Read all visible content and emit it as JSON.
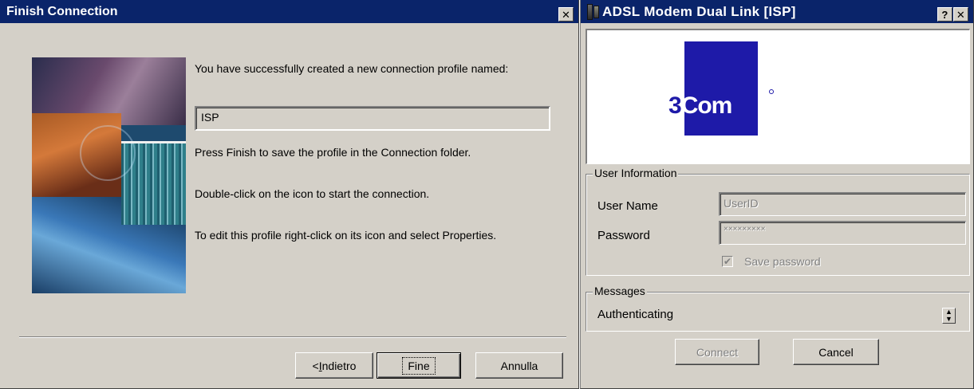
{
  "finish_dialog": {
    "title": "Finish Connection",
    "close_glyph": "✕",
    "intro_text": "You have successfully created a new connection profile named:",
    "profile_name": "ISP",
    "line_save": "Press Finish to save the profile in the Connection folder.",
    "line_start": "Double-click on the icon to start the connection.",
    "line_edit": "To edit this profile right-click on its icon and select Properties.",
    "back_prefix": "< ",
    "back_mnemonic": "I",
    "back_rest": "ndietro",
    "finish_label": "Fine",
    "cancel_label": "Annulla"
  },
  "adsl_dialog": {
    "title": "ADSL Modem Dual Link [ISP]",
    "help_glyph": "?",
    "close_glyph": "✕",
    "logo_text_3": "3",
    "logo_text_com": "Com",
    "user_info_label": "User Information",
    "user_name_label": "User Name",
    "user_name_value": "UserID",
    "password_label": "Password",
    "password_value": "×××××××××",
    "save_password_label": "Save password",
    "save_password_checked": true,
    "messages_label": "Messages",
    "message_text": "Authenticating",
    "connect_label": "Connect",
    "cancel_label": "Cancel"
  },
  "colors": {
    "title_bar": "#0a246a",
    "dialog_face": "#d4d0c8",
    "logo_blue": "#1e1aa8"
  }
}
